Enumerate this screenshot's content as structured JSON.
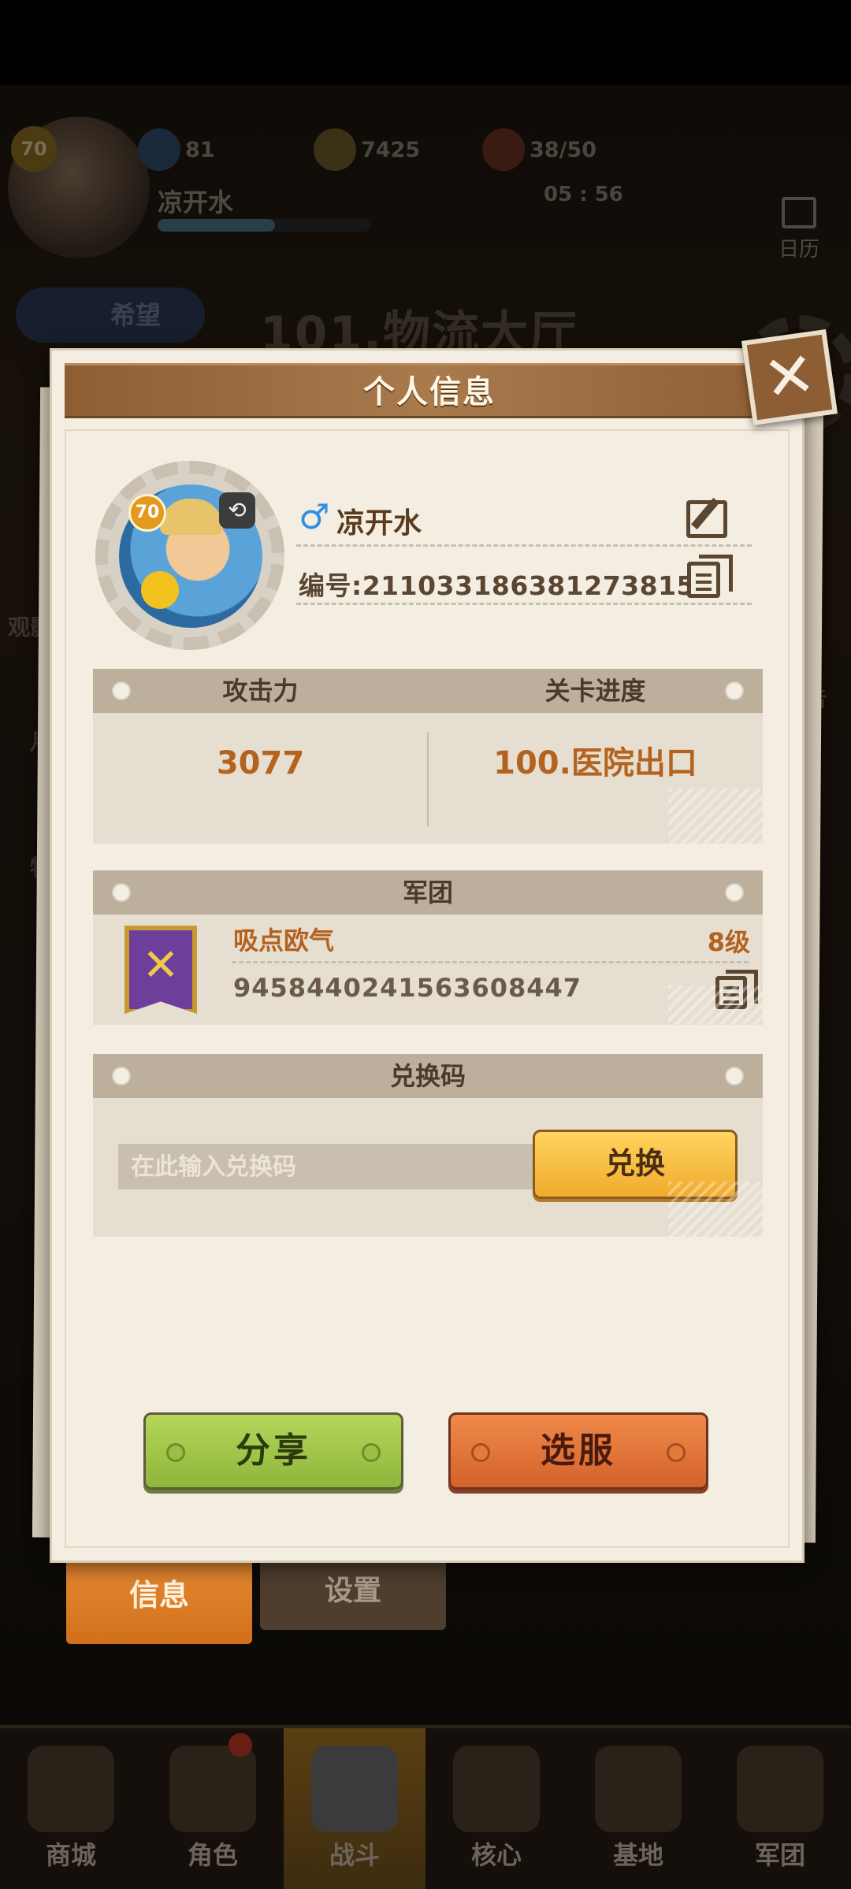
{
  "background": {
    "player_level": "70",
    "player_name": "凉开水",
    "gems": "81",
    "gold": "7425",
    "stamina": "38/50",
    "stamina_timer": "05 : 56",
    "calendar_label": "日历",
    "current_stage": "101.物流大厅",
    "hope_label": "希望",
    "side_labels": [
      "观影",
      "月",
      "特"
    ],
    "side_label_right": "告"
  },
  "bottom_tabs": {
    "info_label": "信息",
    "settings_label": "设置"
  },
  "bottom_nav": [
    {
      "label": "商城"
    },
    {
      "label": "角色"
    },
    {
      "label": "战斗"
    },
    {
      "label": "核心"
    },
    {
      "label": "基地"
    },
    {
      "label": "军团"
    }
  ],
  "popup": {
    "title": "个人信息",
    "profile": {
      "level": "70",
      "gender_symbol": "♂",
      "name": "凉开水",
      "uid_text": "编号:2110331863812738153"
    },
    "stats": {
      "attack_label": "攻击力",
      "attack_value": "3077",
      "progress_label": "关卡进度",
      "progress_value": "100.医院出口"
    },
    "legion": {
      "section_title": "军团",
      "name": "吸点欧气",
      "level": "8级",
      "id": "945844024156360844​7"
    },
    "redeem": {
      "section_title": "兑换码",
      "placeholder": "在此输入兑换码",
      "button_label": "兑换"
    },
    "share_label": "分享",
    "server_label": "选服"
  },
  "colors": {
    "panel_bg": "#f4eee2",
    "header_brown": "#8d5d34",
    "accent_orange": "#b3621f",
    "share_green": "#9bc447",
    "server_orange": "#e0733a",
    "redeem_yellow": "#f7c143"
  }
}
